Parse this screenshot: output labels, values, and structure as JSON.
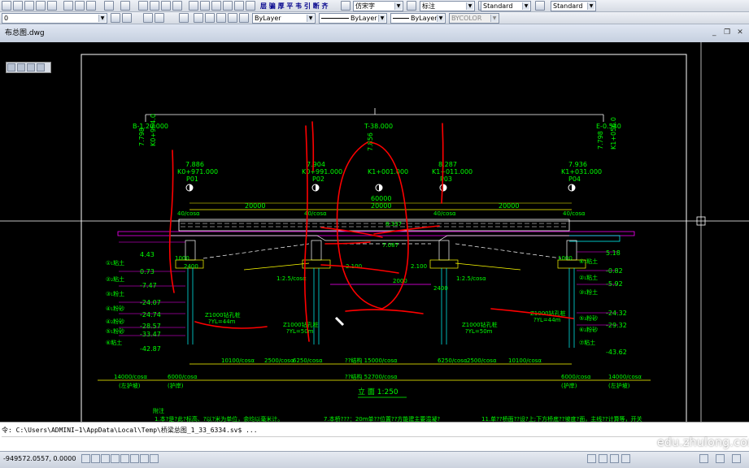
{
  "toolbar": {
    "layer": "0",
    "text_style": "仿宋字",
    "dim_style": "标注",
    "table_style": "Standard",
    "multileader_style": "Standard",
    "color": "ByLayer",
    "linetype": "ByLayer",
    "lineweight": "ByLayer",
    "plot_style": "BYCOLOR",
    "cn_tools": "层 骗 厚 平 韦 引 断 齐"
  },
  "document": {
    "tab": "布总图.dwg"
  },
  "drawing": {
    "left": {
      "name": "B-1.20.000",
      "station": "K0+964.0",
      "elev": "7.798"
    },
    "right": {
      "name": "E-0.540",
      "station": "K1+056.0",
      "elev": "7.798"
    },
    "center": {
      "name": "T-38.000",
      "elev": "7.856"
    },
    "piers": [
      {
        "elev": "7.886",
        "station": "K0+971.000",
        "id": "P01"
      },
      {
        "elev": "7.904",
        "station": "K0+991.000",
        "id": "P02"
      },
      {
        "elev": "",
        "station": "K1+001.000",
        "id": ""
      },
      {
        "elev": "8.287",
        "station": "K1+011.000",
        "id": "P03"
      },
      {
        "elev": "7.936",
        "station": "K1+031.000",
        "id": "P04"
      }
    ],
    "spans": [
      "20000",
      "20000",
      "20000"
    ],
    "total_span": "60000",
    "slopes": [
      "40/cosα",
      "40/cosα",
      "40/cosα",
      "40/cosα"
    ],
    "left_elevs": [
      "4.43",
      "0.73",
      "-7.47",
      "-24.07",
      "-24.74",
      "-28.57",
      "-33.47",
      "-42.87"
    ],
    "right_elevs": [
      "5.18",
      "-0.82",
      "-5.92",
      "-24.32",
      "-29.32",
      "-43.62"
    ],
    "left_layers": [
      "①₁粘土",
      "②₂粘土",
      "③₁粉土",
      "④₁粉砂",
      "④₂粉砂",
      "⑤₁粉砂",
      "⑥粘土"
    ],
    "right_layers": [
      "⑥₁粘土",
      "②₁粘土",
      "③₁粉土",
      "⑤₃粉砂",
      "⑥₂粉砂",
      "⑦粘土"
    ],
    "annotations": [
      "1:2.5/cosα",
      "1:2.5/cosα",
      "2.100",
      "2.100",
      "7.087",
      "8.337",
      "1000",
      "2400",
      "2400",
      "2000",
      "1000"
    ],
    "piles": [
      "Z1000钻孔桩",
      "Z1000钻孔桩",
      "Z1000钻孔桩",
      "Z1000钻孔桩"
    ],
    "pile_lengths": [
      "?YL=44m",
      "?YL=50m",
      "?YL=50m",
      "?YL=44m"
    ],
    "dims_row1": [
      "10100/cosα",
      "2500/cosα",
      "6250/cosα",
      "??结构 15000/cosα",
      "6250/cosα",
      "2500/cosα",
      "10100/cosα"
    ],
    "dims_row2": [
      "14000/cosα",
      "6000/cosα",
      "??结构 52700/cosα",
      "6000/cosα",
      "14000/cosα"
    ],
    "dims_row2_sub": [
      "(左护坡)",
      "(护岸)",
      "(护岸)",
      "(左护坡)"
    ],
    "title": "立   面   1:250",
    "notes_title": "附注",
    "notes": [
      "1.本?是?此?标高、?以?米为单位，余均以毫米计。",
      "7.本桥???：20m单??位置??方能建主要混凝?",
      "11.单??桥面??设?上;下方桥底??坡度?面，主线??计算等，开关"
    ]
  },
  "command": {
    "history": "令: C:\\Users\\ADMINI~1\\AppData\\Local\\Temp\\桥梁总图_1_33_6334.sv$ ...",
    "prompt": ""
  },
  "status": {
    "coords": "-949572.0557, 0.0000"
  },
  "watermark": "edu.zhulong.com",
  "colors": {
    "cad_green": "#00ff00",
    "cad_white": "#ffffff",
    "cad_magenta": "#ff00ff",
    "cad_red": "#ff0000",
    "cad_cyan": "#00ffff"
  }
}
